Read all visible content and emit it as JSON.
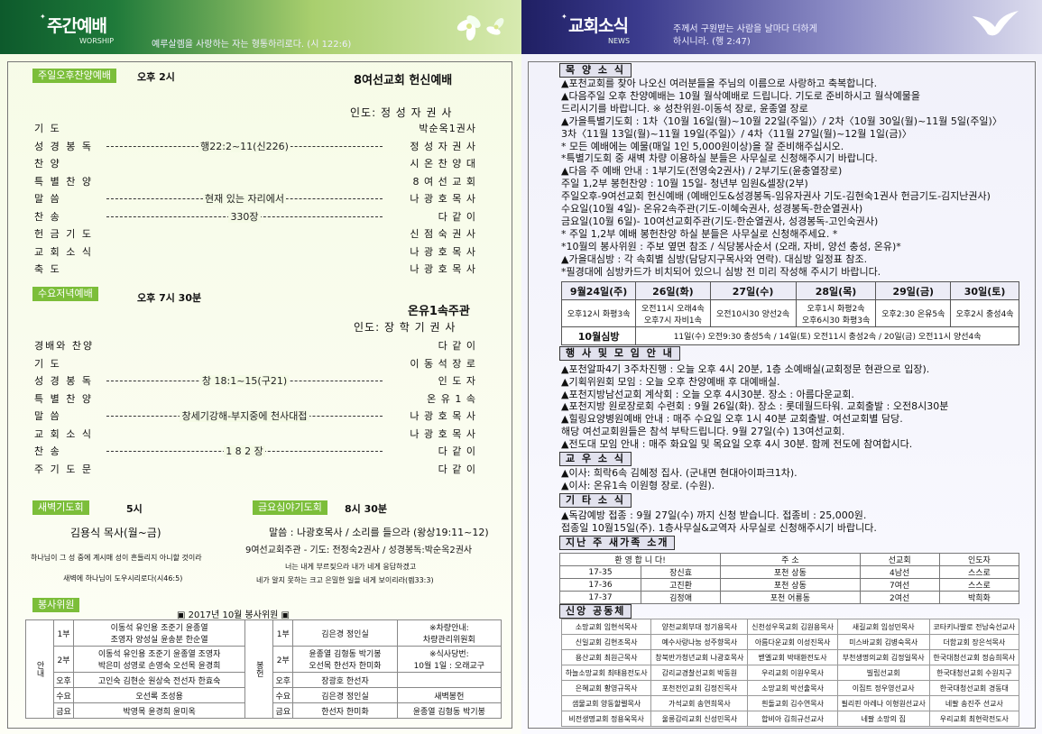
{
  "left": {
    "header": {
      "title": "주간예배",
      "en": "WORSHIP",
      "verse": "예루살렘을 사랑하는 자는 형통하리로다. (시 122:6)"
    },
    "sunday": {
      "label": "주일오후찬양예배",
      "time": "오후 2시",
      "title": "8여선교회 헌신예배",
      "leader": "인도:  정 성 자 권 사",
      "rows": [
        [
          "기     도",
          "",
          "박순옥1권사"
        ],
        [
          "성 경 봉 독",
          "행22:2~11(신226)",
          "정 성 자 권 사"
        ],
        [
          "찬     양",
          "",
          "시 온 찬 양 대"
        ],
        [
          "특 별 찬 양",
          "",
          "8 여 선 교 회"
        ],
        [
          "말     씀",
          "현재 있는 자리에서",
          "나 광 호 목 사"
        ],
        [
          "찬     송",
          "330장",
          "다    같    이"
        ],
        [
          "헌 금 기 도",
          "",
          "신 점 숙 권 사"
        ],
        [
          "교 회 소 식",
          "",
          "나 광 호 목 사"
        ],
        [
          "축     도",
          "",
          "나 광 호 목 사"
        ]
      ]
    },
    "wednesday": {
      "label": "수요저녁예배",
      "time": "오후 7시 30분",
      "title": "온유1속주관",
      "leader": "인도: 장 학 기 권 사",
      "rows": [
        [
          "경배와 찬양",
          "",
          "다    같    이"
        ],
        [
          "기     도",
          "",
          "이 동 석 장 로"
        ],
        [
          "성 경 봉 독",
          "창 18:1~15(구21)",
          "인    도    자"
        ],
        [
          "특 별 찬 양",
          "",
          "온  유  1  속"
        ],
        [
          "말     씀",
          "창세기강해-부지중에 천사대접",
          "나 광 호 목 사"
        ],
        [
          "교 회 소 식",
          "",
          "나 광 호 목 사"
        ],
        [
          "찬     송",
          "1 8 2 장",
          "다    같    이"
        ],
        [
          "주 기 도 문",
          "",
          "다    같    이"
        ]
      ]
    },
    "dawn": {
      "label": "새벽기도회",
      "time": "5시",
      "who": "김용식 목사(월~금)",
      "verse1": "하나님이 그 성 중에 계시매 성이 흔들리지 아니할 것이라",
      "verse2": "새벽에 하나님이 도우시리로다(시46:5)"
    },
    "friday": {
      "label": "금요심야기도회",
      "time": "8시 30분",
      "sermon": "말씀 : 나광호목사 / 소리를 들으라 (왕상19:11~12)",
      "prayer": "9여선교회주관 - 기도: 전정숙2권사 / 성경봉독:박순옥2권사",
      "verse1": "너는 내게 부르짖으라 내가 네게 응답하겠고",
      "verse2": "네가 알지 못하는 크고 은밀한 일을 네게 보이리라(렘33:3)"
    },
    "volunteers": {
      "label": "봉사위원",
      "title": "▣  2017년  10월  봉사위원  ▣",
      "guide": "안내",
      "serve": "봉헌",
      "rows": [
        [
          "1부",
          "이동석 유인용 조준기 윤종열\n조영자 양성실 윤송분 한순열",
          "1부",
          "김은경 정인실",
          "※차량안내:\n차량관리위원회"
        ],
        [
          "2부",
          "이동석 유인용 조준기 윤종열 조영자\n박은미 성영로 손영숙 오선목 윤경희",
          "2부",
          "윤종열 김형동 박기봉\n오선목 한선자 한미화",
          "※식사당번:\n10월 1일 : 오래교구"
        ],
        [
          "오후",
          "고인숙 김현순 원상숙 전선자 한효숙",
          "오후",
          "장광호 한선자",
          ""
        ],
        [
          "수요",
          "오선록 조성용",
          "수요",
          "김은경 정인실",
          "새벽봉헌"
        ],
        [
          "금요",
          "박영목 윤경희 윤미옥",
          "금요",
          "한선자 한미화",
          "윤종열 김형동 박기봉"
        ]
      ]
    }
  },
  "right": {
    "header": {
      "title": "교회소식",
      "en": "NEWS",
      "verse": "주께서 구원받는 사람을 날마다 더하게 하시니라. (행 2:47)"
    },
    "s1": "목 양 소 식",
    "news1": [
      "▲포천교회를 찾아 나오신 여러분들을 주님의 이름으로 사랑하고 축복합니다.",
      "▲다음주일 오후 찬양예배는 10월 월삭예배로 드립니다. 기도로 준비하시고 월삭예물을",
      "  드리시기를 바랍니다.  ※ 성찬위원-이동석 장로, 윤종열 장로",
      "▲가을특별기도회 : 1차〈10월 16일(월)~10월 22일(주일)〉/ 2차〈10월 30일(월)~11월 5일(주일)〉",
      "                    3차〈11월 13일(월)~11월 19일(주일)〉/ 4차〈11월 27일(월)~12월 1일(금)〉",
      "* 모든 예배에는 예물(매일 1인 5,000원이상)을 잘 준비해주십시오.",
      "*특별기도회 중 새벽 차량 이용하실 분들은 사무실로 신청해주시기 바랍니다.",
      "▲다음 주 예배 안내 : 1부기도(전영숙2권사) / 2부기도(윤충열장로)",
      "  주일 1,2부 봉헌찬양 : 10월 15일- 청년부 임원&셀장(2부)",
      "  주일오후-9여선교회 헌신예배 (예배인도&성경봉독-임유자권사 기도-김현숙1권사 헌금기도-김지난권사)",
      "  수요일(10월 4일)- 온유2속주관(기도-이혜숙권사, 성경봉독-한순열권사)",
      "  금요일(10월 6일)- 10여선교회주관(기도-한순열권사, 성경봉독-고인숙권사)",
      "  * 주일 1,2부 예배 봉헌찬양 하실 분들은 사무실로 신청해주세요. *",
      "  *10월의 봉사위원 : 주보 옆면 참조 / 식당봉사순서 (오래, 자비, 양선 충성, 온유)*",
      "▲가을대심방 : 각 속회별 심방(담당지구목사와 연락). 대심방 일정표 참조.",
      "*필경대에 심방카드가 비치되어 있으니 심방 전 미리 작성해 주시기 바랍니다."
    ],
    "schedule": {
      "days": [
        "9월24일(주)",
        "26일(화)",
        "27일(수)",
        "28일(목)",
        "29일(금)",
        "30일(토)"
      ],
      "cells": [
        "오후12시 화평3속",
        "오전11시 오래4속\n오후7시 자비1속",
        "오전10시30 양선2속",
        "오후1시 화평2속\n오후6시30 화평3속",
        "오후2:30 온유5속",
        "오후2시 충성4속"
      ],
      "oct": "10월심방",
      "octText": "11일(수) 오전9:30 충성5속 / 14일(토) 오전11시 충성2속 / 20일(금) 오전11시 양선4속"
    },
    "s2": "행 사 및 모 임 안 내",
    "news2": [
      "▲포천알파4기 3주차진행 : 오늘 오후 4시 20분, 1층 소예배실(교회정문 현관으로 입장).",
      "▲기획위원회 모임 : 오늘 오후 찬양예배 후 대예배실.",
      "▲포천지방남선교회 계삭회 : 오늘 오후 4시30분. 장소 : 아름다운교회.",
      "▲포천지방 원로장로회 수련회 : 9월 26일(화). 장소 : 롯데월드타워. 교회출발 : 오전8시30분",
      "▲힐링요양병원예배 안내 : 매주 수요일 오후 1시 40분 교회출발. 여선교회별 담당.",
      "  해당 여선교회원들은 참석 부탁드립니다. 9월 27일(수) 13여선교회.",
      "▲전도대 모임 안내 : 매주 화요일 및 목요일 오후 4시 30분. 함께 전도에 참여합시다."
    ],
    "s3": "교 우 소 식",
    "news3": [
      "▲이사: 희락6속 김혜정 집사. (군내면 현대아이파크1차).",
      "▲이사: 온유1속 이원형 장로. (수원)."
    ],
    "s4": "기 타 소 식",
    "news4": [
      "▲독감예방 접종 : 9월 27일(수) 까지 신청 받습니다. 접종비 : 25,000원.",
      "  접종일 10월15일(주). 1층사무실&교역자 사무실로 신청해주시기 바랍니다."
    ],
    "s5": "지난 주 새가족 소개",
    "newcomers": {
      "head": [
        "환 영 합 니 다!",
        "주  소",
        "선교회",
        "인도자"
      ],
      "rows": [
        [
          "17-35",
          "장신효",
          "포천 상동",
          "4남선",
          "스스로"
        ],
        [
          "17-36",
          "고진환",
          "포천 상동",
          "7여선",
          "스스로"
        ],
        [
          "17-37",
          "김정애",
          "포천 어룡동",
          "2여선",
          "박희화"
        ]
      ]
    },
    "s6": "신앙 공동체",
    "community": [
      [
        "소망교회 임현석목사",
        "양천교회부대 정기용목사",
        "신천성우목교회 김원용목사",
        "새길교회 임성민목사",
        "코타키나발로 전남숙선교사"
      ],
      [
        "신일교회 김현조목사",
        "예수사랑나눔 성주향목사",
        "아름다운교회 이성진목사",
        "미스바교회 김병숙목사",
        "더함교회 장은석목사"
      ],
      [
        "용산교회 최원근목사",
        "창북반가청년교회 나광호목사",
        "벧엘교회 박태환전도사",
        "부천생명의교회 김정일목사",
        "한국대청선교회 정승희목사"
      ],
      [
        "하늘소망교회 최태용전도사",
        "감리교경찰선교회 박동원",
        "우리교회 이원우목사",
        "빌립선교회",
        "한국대청선교회 수원지구"
      ],
      [
        "은혜교회 황영규목사",
        "포천전인교회 김정진목사",
        "소망교회 박선출목사",
        "이집트 정우영선교사",
        "한국대청선교회 경동대"
      ],
      [
        "샘물교회 양동할렐목사",
        "가석교회 송연희목사",
        "흰돌교회 김수연목사",
        "필리핀 아레나 이형원선교사",
        "네팔 송진주 선교사"
      ],
      [
        "비전생명교회 정용욱목사",
        "울릉감리교회 신성민목사",
        "합비아 김희규선교사",
        "네팔 소망의 집",
        "우리교회 최현락전도사"
      ]
    ]
  }
}
